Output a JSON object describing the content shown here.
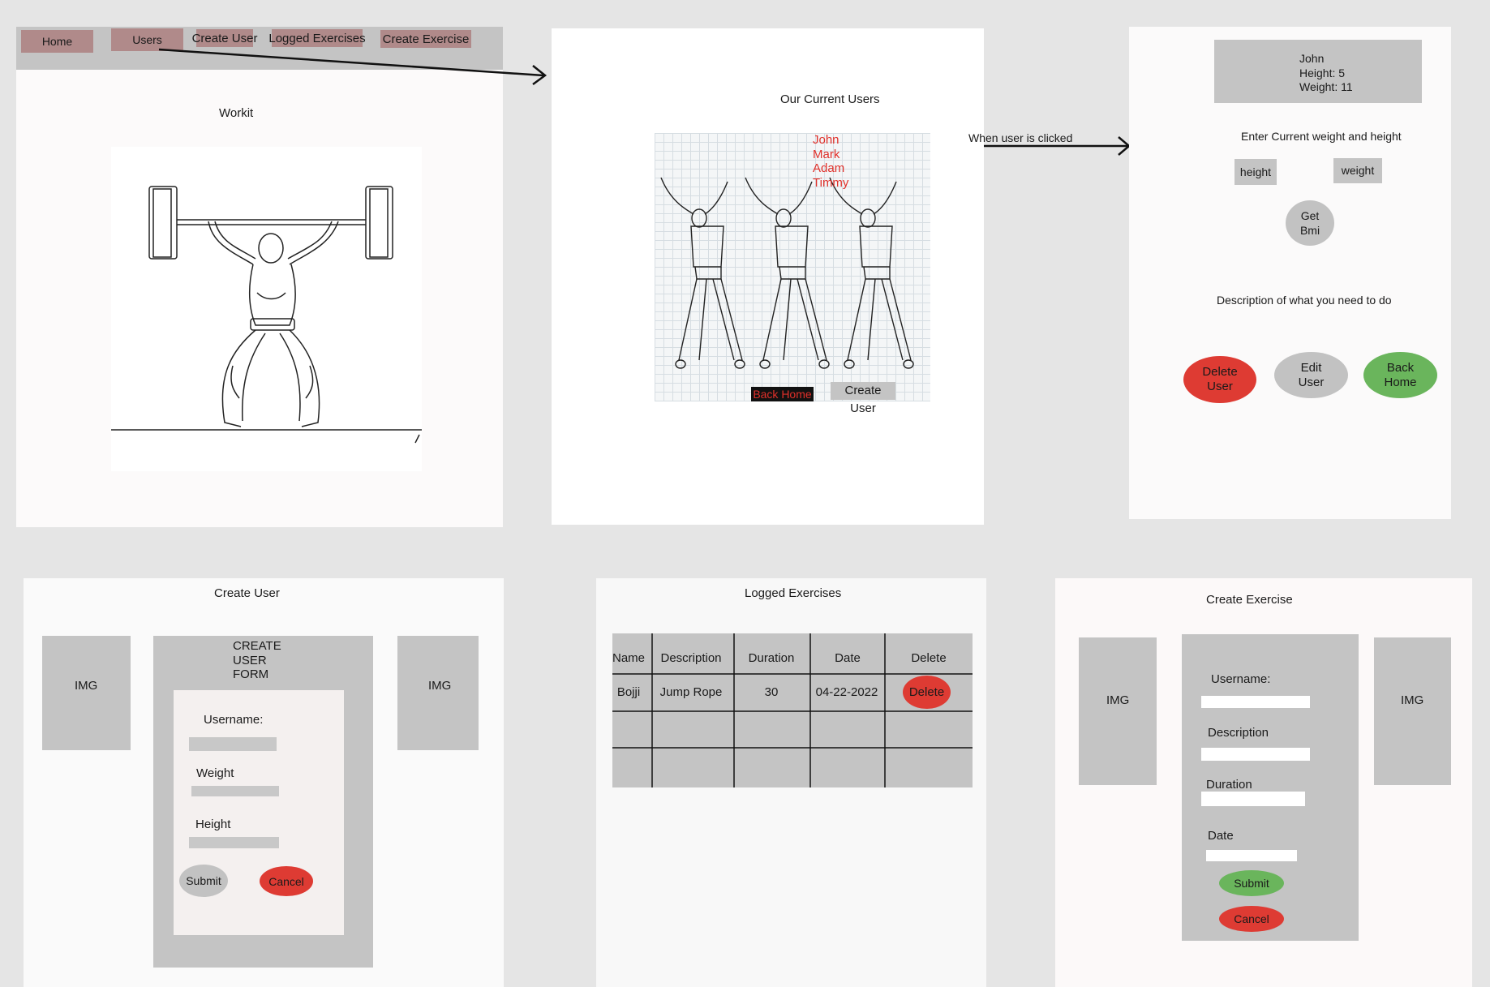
{
  "nav": {
    "home": "Home",
    "users": "Users",
    "create_user": "Create User",
    "logged_exercises": "Logged Exercises",
    "create_exercise": "Create Exercise"
  },
  "home_frame": {
    "title": "Workit"
  },
  "users_frame": {
    "title": "Our Current Users",
    "names": [
      "John",
      "Mark",
      "Adam",
      "Timmy"
    ],
    "back_home": "Back Home",
    "create_user": "Create User",
    "annotation": "When user is clicked"
  },
  "user_detail": {
    "info": [
      "John",
      "Height:  5",
      "Weight: 11"
    ],
    "prompt": "Enter Current weight and height",
    "height": "height",
    "weight": "weight",
    "get_bmi": [
      "Get",
      "Bmi"
    ],
    "description": "Description of what you need to do",
    "delete_user": [
      "Delete",
      "User"
    ],
    "edit_user": [
      "Edit",
      "User"
    ],
    "back_home": [
      "Back",
      "Home"
    ]
  },
  "create_user_frame": {
    "title": "Create User",
    "img_left": "IMG",
    "img_right": "IMG",
    "form_title": [
      "CREATE",
      "USER",
      "FORM"
    ],
    "username": "Username:",
    "weight": "Weight",
    "height": "Height",
    "submit": "Submit",
    "cancel": "Cancel"
  },
  "logged_frame": {
    "title": "Logged Exercises",
    "headers": [
      "Name",
      "Description",
      "Duration",
      "Date",
      "Delete"
    ],
    "row": [
      "Bojji",
      "Jump Rope",
      "30",
      "04-22-2022"
    ],
    "delete": "Delete"
  },
  "create_exercise_frame": {
    "title": "Create Exercise",
    "img_left": "IMG",
    "img_right": "IMG",
    "username": "Username:",
    "description": "Description",
    "duration": "Duration",
    "date": "Date",
    "submit": "Submit",
    "cancel": "Cancel"
  },
  "colors": {
    "canvas": "#e5e5e5",
    "nav_button": "#b08a8a",
    "red": "#de3b33",
    "green": "#6ab55c",
    "gray": "#c2c2c2",
    "name_red": "#e0302a"
  }
}
